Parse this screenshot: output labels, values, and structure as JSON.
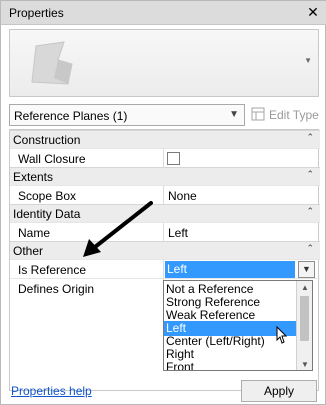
{
  "window": {
    "title": "Properties",
    "close_glyph": "✕"
  },
  "type_selector": {
    "value": "Reference Planes (1)",
    "edit_type_label": "Edit Type"
  },
  "sections": {
    "construction": {
      "label": "Construction",
      "wall_closure": {
        "name": "Wall Closure",
        "checked": false
      }
    },
    "extents": {
      "label": "Extents",
      "scope_box": {
        "name": "Scope Box",
        "value": "None"
      }
    },
    "identity": {
      "label": "Identity Data",
      "name": {
        "name": "Name",
        "value": "Left"
      }
    },
    "other": {
      "label": "Other",
      "is_reference": {
        "name": "Is Reference",
        "value": "Left"
      },
      "defines_origin": {
        "name": "Defines Origin"
      }
    }
  },
  "dropdown": {
    "options": [
      "Not a Reference",
      "Strong Reference",
      "Weak Reference",
      "Left",
      "Center (Left/Right)",
      "Right",
      "Front"
    ],
    "selected": "Left"
  },
  "footer": {
    "help_label": "Properties help",
    "apply_label": "Apply"
  },
  "colors": {
    "selection": "#3399ff",
    "link": "#1155cc",
    "section_bg": "#ececec",
    "titlebar_bg": "#dcdcdc"
  },
  "icons": [
    "close-icon",
    "reference-plane-thumbnail-icon",
    "chevron-down-icon",
    "edit-type-icon",
    "collapse-chevron-icon",
    "mouse-pointer-icon",
    "callout-arrow"
  ]
}
